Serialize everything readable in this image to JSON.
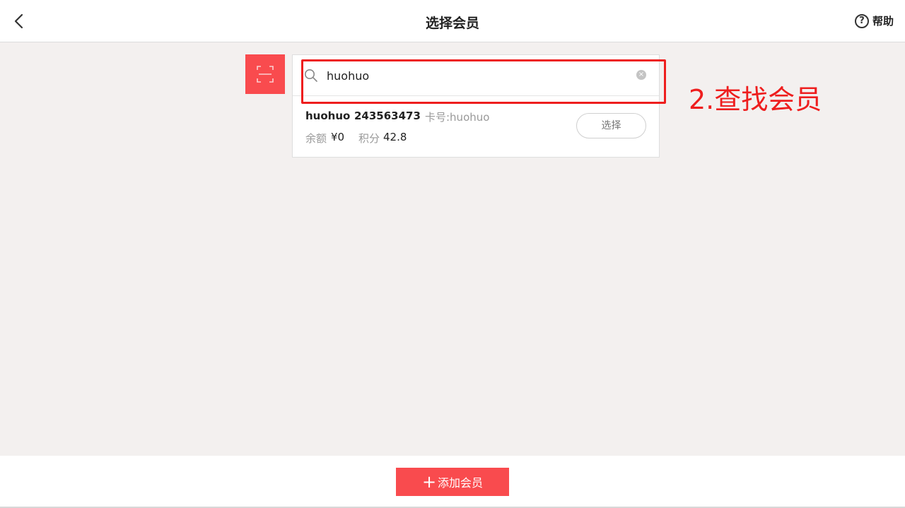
{
  "header": {
    "title": "选择会员",
    "help_label": "帮助",
    "help_icon_glyph": "?"
  },
  "search": {
    "value": "huohuo",
    "clear_glyph": "×"
  },
  "member": {
    "name": "huohuo",
    "phone": "243563473",
    "card": "卡号:huohuo",
    "balance_label": "余额",
    "balance_value": "¥0",
    "points_label": "积分",
    "points_value": "42.8",
    "select_label": "选择"
  },
  "annotation": {
    "label": "2.查找会员",
    "color": "#ee1e1e"
  },
  "footer": {
    "add_plus": "+",
    "add_label": "添加会员"
  },
  "colors": {
    "accent": "#f94b4e",
    "background": "#f3f0ef"
  },
  "icons": [
    "back-icon",
    "help-icon",
    "scan-icon",
    "search-icon",
    "clear-icon",
    "plus-icon"
  ]
}
